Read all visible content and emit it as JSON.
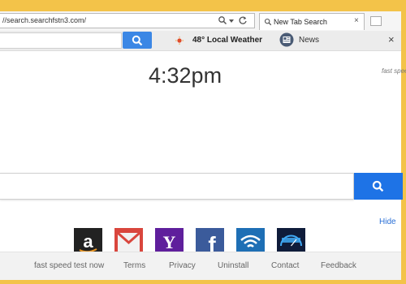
{
  "browser": {
    "address_text": "//search.searchfstn3.com/",
    "tab_label": "New Tab Search"
  },
  "toolbar": {
    "weather_text": "48° Local Weather",
    "news_label": "News"
  },
  "main": {
    "clock": "4:32pm",
    "brand_logo": "fast speed",
    "hide_label": "Hide"
  },
  "tiles": [
    "amazon-icon",
    "gmail-icon",
    "yahoo-icon",
    "facebook-icon",
    "wifi-icon",
    "speed-test-icon"
  ],
  "footer": {
    "links": [
      "fast speed test now",
      "Terms",
      "Privacy",
      "Uninstall",
      "Contact",
      "Feedback"
    ]
  },
  "colors": {
    "frame": "#f3c349",
    "search_button": "#1e73e6",
    "toolbar_search_button": "#3b87e5",
    "link": "#2a6fd6"
  }
}
